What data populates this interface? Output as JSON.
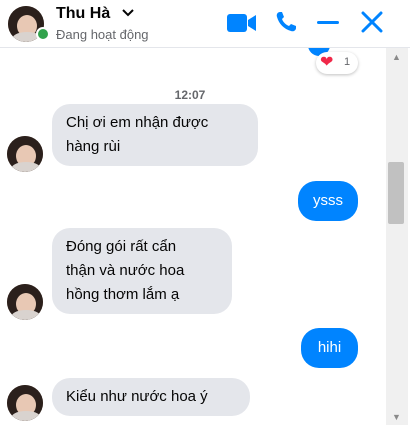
{
  "header": {
    "contact_name": "Thu Hà",
    "status_text": "Đang hoạt động",
    "accent_color": "#0084ff",
    "online_color": "#31a24c"
  },
  "icons": [
    "chevron-down-icon",
    "video-call-icon",
    "phone-icon",
    "minimize-icon",
    "close-icon",
    "heart-icon"
  ],
  "conversation": {
    "reaction": {
      "emoji": "❤",
      "count": "1"
    },
    "timestamp": "12:07",
    "messages": [
      {
        "from": "them",
        "lines": [
          "Chị ơi em nhận được",
          "hàng rùi"
        ]
      },
      {
        "from": "me",
        "lines": [
          "ysss"
        ]
      },
      {
        "from": "them",
        "lines": [
          "Đóng gói rất cẩn",
          "thận và nước hoa",
          "hồng thơm lắm ạ"
        ]
      },
      {
        "from": "me",
        "lines": [
          "hihi"
        ]
      },
      {
        "from": "them",
        "lines": [
          "Kiểu như nước hoa ý"
        ]
      }
    ]
  }
}
